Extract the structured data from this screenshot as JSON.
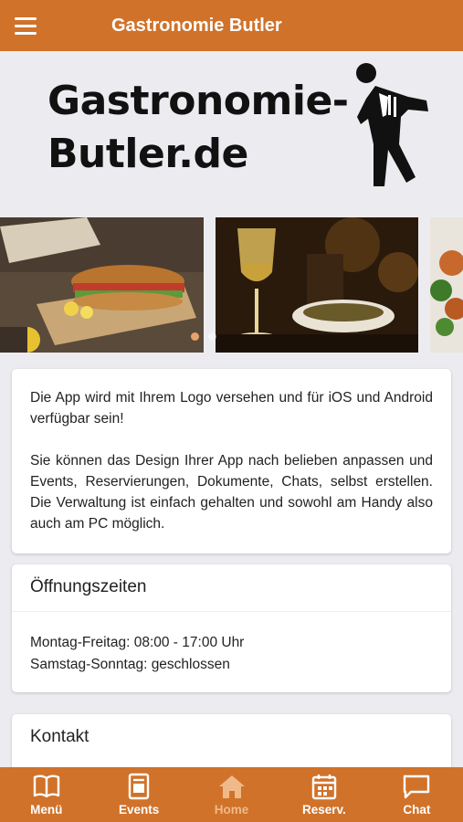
{
  "header": {
    "title": "Gastronomie Butler",
    "menu_icon": "hamburger-menu-icon"
  },
  "hero": {
    "logo_line1": "Gastronomie-",
    "logo_line2": "Butler.de",
    "logo_figure": "butler-figure-icon"
  },
  "carousel": {
    "slides": [
      "sandwich-photo",
      "wine-restaurant-photo",
      "salad-photo"
    ],
    "active_index": 0,
    "dot_count": 2
  },
  "intro": {
    "paragraph1": "Die App wird mit Ihrem Logo versehen und für iOS und Android verfügbar sein!",
    "paragraph2": "Sie können das Design Ihrer App nach belieben anpassen und Events, Reservierungen, Dokumente, Chats, selbst erstellen. Die Verwaltung ist einfach gehalten und sowohl am Handy also auch am PC möglich."
  },
  "hours": {
    "title": "Öffnungszeiten",
    "line1": "Montag-Freitag: 08:00 - 17:00 Uhr",
    "line2": "Samstag-Sonntag: geschlossen"
  },
  "contact": {
    "title": "Kontakt"
  },
  "tabs": [
    {
      "label": "Menü",
      "icon": "book-icon",
      "active": false
    },
    {
      "label": "Events",
      "icon": "events-icon",
      "active": false
    },
    {
      "label": "Home",
      "icon": "home-icon",
      "active": true
    },
    {
      "label": "Reserv.",
      "icon": "calendar-icon",
      "active": false
    },
    {
      "label": "Chat",
      "icon": "chat-icon",
      "active": false
    }
  ],
  "colors": {
    "brand": "#d0722a",
    "active_tab": "#f0b98a",
    "background": "#ececf0"
  }
}
